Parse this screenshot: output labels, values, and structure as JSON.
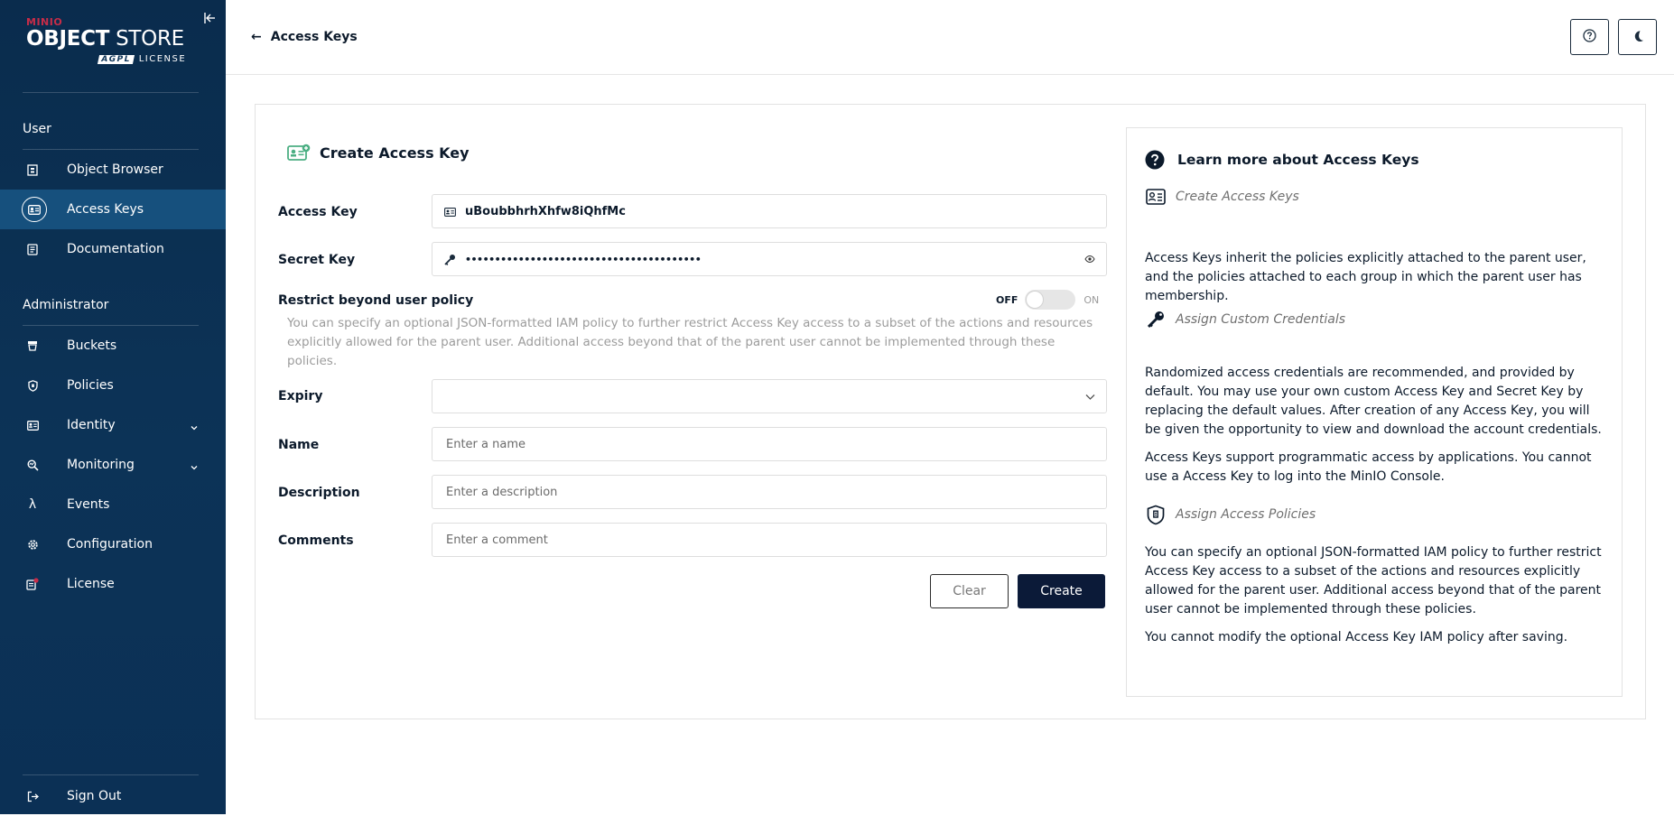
{
  "logo": {
    "small": "MINIO",
    "main_bold": "OBJECT",
    "main_light": " STORE",
    "agpl": "AGPL",
    "license": "LICENSE"
  },
  "sidebar": {
    "user_section": "User",
    "admin_section": "Administrator",
    "user_items": [
      {
        "label": "Object Browser",
        "icon": "object-browser-icon"
      },
      {
        "label": "Access Keys",
        "icon": "access-keys-icon",
        "active": true
      },
      {
        "label": "Documentation",
        "icon": "documentation-icon"
      }
    ],
    "admin_items": [
      {
        "label": "Buckets",
        "icon": "buckets-icon"
      },
      {
        "label": "Policies",
        "icon": "policies-icon"
      },
      {
        "label": "Identity",
        "icon": "identity-icon",
        "expandable": true
      },
      {
        "label": "Monitoring",
        "icon": "monitoring-icon",
        "expandable": true
      },
      {
        "label": "Events",
        "icon": "lambda-icon"
      },
      {
        "label": "Configuration",
        "icon": "gear-icon"
      },
      {
        "label": "License",
        "icon": "license-icon"
      }
    ],
    "sign_out": "Sign Out"
  },
  "header": {
    "back_label": "Access Keys"
  },
  "form": {
    "title": "Create Access Key",
    "access_key_label": "Access Key",
    "access_key_value": "uBoubbhrhXhfw8iQhfMc",
    "secret_key_label": "Secret Key",
    "secret_key_masked": "••••••••••••••••••••••••••••••••••••••••",
    "restrict_label": "Restrict beyond user policy",
    "toggle_off": "OFF",
    "toggle_on": "ON",
    "restrict_help": "You can specify an optional JSON-formatted IAM policy to further restrict Access Key access to a subset of the actions and resources explicitly allowed for the parent user. Additional access beyond that of the parent user cannot be implemented through these policies.",
    "expiry_label": "Expiry",
    "name_label": "Name",
    "name_placeholder": "Enter a name",
    "description_label": "Description",
    "description_placeholder": "Enter a description",
    "comments_label": "Comments",
    "comments_placeholder": "Enter a comment",
    "clear_label": "Clear",
    "create_label": "Create"
  },
  "help": {
    "title": "Learn more about Access Keys",
    "sections": [
      {
        "heading": "Create Access Keys",
        "icon": "access-key-card-icon",
        "paragraphs": [
          "Access Keys inherit the policies explicitly attached to the parent user, and the policies attached to each group in which the parent user has membership."
        ]
      },
      {
        "heading": "Assign Custom Credentials",
        "icon": "key-icon",
        "paragraphs": [
          "Randomized access credentials are recommended, and provided by default. You may use your own custom Access Key and Secret Key by replacing the default values. After creation of any Access Key, you will be given the opportunity to view and download the account credentials.",
          "Access Keys support programmatic access by applications. You cannot use a Access Key to log into the MinIO Console."
        ]
      },
      {
        "heading": "Assign Access Policies",
        "icon": "shield-icon",
        "paragraphs": [
          "You can specify an optional JSON-formatted IAM policy to further restrict Access Key access to a subset of the actions and resources explicitly allowed for the parent user. Additional access beyond that of the parent user cannot be implemented through these policies.",
          "You cannot modify the optional Access Key IAM policy after saving."
        ]
      }
    ]
  },
  "colors": {
    "sidebar_bg": "#0c3357",
    "sidebar_active": "#16507d",
    "primary_button": "#0b1a38",
    "brand_red": "#c72c48",
    "accent_green": "#4caf83"
  }
}
